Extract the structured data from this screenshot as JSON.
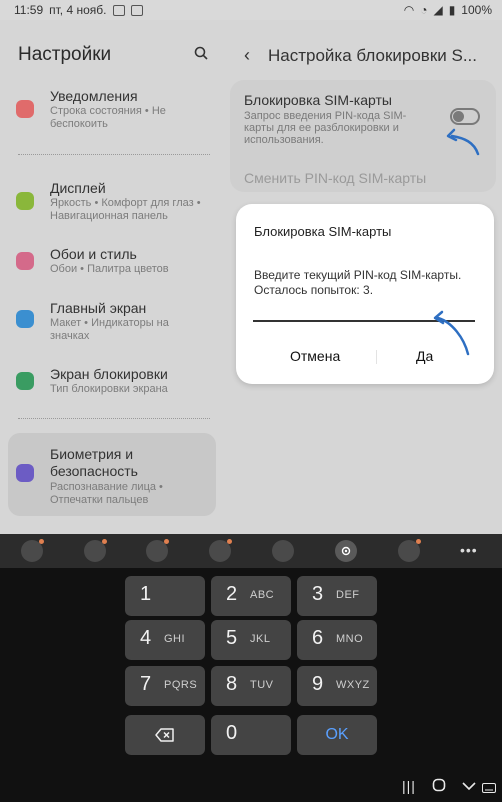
{
  "status_bar": {
    "time": "11:59",
    "date": "пт, 4 нояб.",
    "battery": "100%"
  },
  "left_pane": {
    "title": "Настройки",
    "items": [
      {
        "title": "Уведомления",
        "subtitle": "Строка состояния  •  Не беспокоить",
        "icon": "bell-icon",
        "color": "#e06b6b"
      },
      {
        "title": "Дисплей",
        "subtitle": "Яркость  •  Комфорт для глаз  •  Навигационная панель",
        "icon": "sun-icon",
        "color": "#8ab73b"
      },
      {
        "title": "Обои и стиль",
        "subtitle": "Обои  •  Палитра цветов",
        "icon": "palette-icon",
        "color": "#d46a8a"
      },
      {
        "title": "Главный экран",
        "subtitle": "Макет  •  Индикаторы на значках",
        "icon": "home-icon",
        "color": "#3b8fd0"
      },
      {
        "title": "Экран блокировки",
        "subtitle": "Тип блокировки экрана",
        "icon": "lock-icon",
        "color": "#3a9c62"
      },
      {
        "title": "Биометрия и безопасность",
        "subtitle": "Распознавание лица  •  Отпечатки пальцев",
        "icon": "shield-icon",
        "color": "#6c5cc4"
      }
    ]
  },
  "right_pane": {
    "title": "Настройка блокировки S...",
    "sim_lock_title": "Блокировка SIM-карты",
    "sim_lock_subtitle": "Запрос введения PIN-кода SIM-карты для ее разблокировки и использования.",
    "sim_lock_enabled": false,
    "change_pin_label": "Сменить PIN-код SIM-карты"
  },
  "dialog": {
    "title": "Блокировка SIM-карты",
    "message": "Введите текущий PIN-код SIM-карты. Осталось попыток: 3.",
    "input_value": "",
    "cancel_label": "Отмена",
    "ok_label": "Да"
  },
  "keyboard": {
    "keys": [
      {
        "digit": "1",
        "letters": ""
      },
      {
        "digit": "2",
        "letters": "ABC"
      },
      {
        "digit": "3",
        "letters": "DEF"
      },
      {
        "digit": "4",
        "letters": "GHI"
      },
      {
        "digit": "5",
        "letters": "JKL"
      },
      {
        "digit": "6",
        "letters": "MNO"
      },
      {
        "digit": "7",
        "letters": "PQRS"
      },
      {
        "digit": "8",
        "letters": "TUV"
      },
      {
        "digit": "9",
        "letters": "WXYZ"
      }
    ],
    "zero_label": "0",
    "ok_label": "OK",
    "toolbar_icons": [
      "emoji-icon",
      "sticker-icon",
      "clipboard-icon",
      "gif-icon",
      "mic-icon",
      "gear-icon",
      "search-icon",
      "more-icon"
    ],
    "ok_color": "#5aa0ff"
  },
  "colors": {
    "accent_arrow": "#2e6fc2"
  }
}
